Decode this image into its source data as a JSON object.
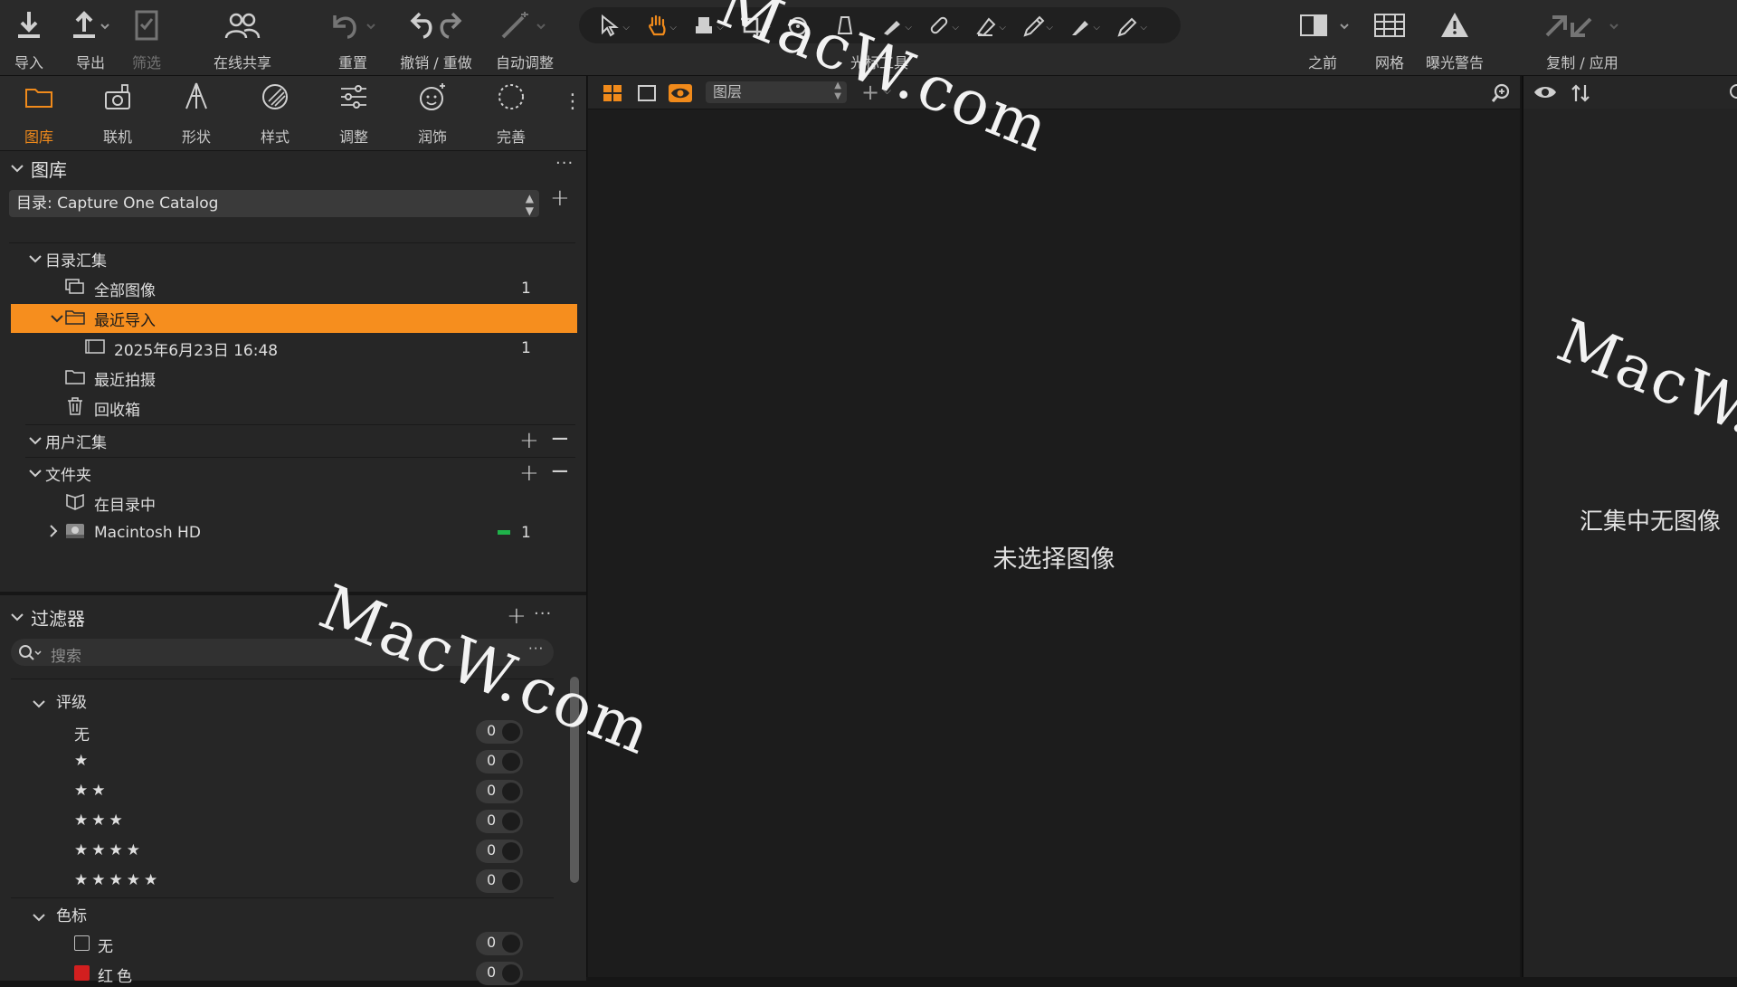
{
  "toolbar": {
    "import": "导入",
    "export": "导出",
    "filter": "筛选",
    "share": "在线共享",
    "reset": "重置",
    "undo_redo": "撤销 / 重做",
    "auto_adjust": "自动调整",
    "cursor_tools": "光标工具",
    "before": "之前",
    "grid": "网格",
    "exposure_warning": "曝光警告",
    "copy_apply": "复制 / 应用"
  },
  "tabs": [
    "图库",
    "联机",
    "形状",
    "样式",
    "调整",
    "润饰",
    "完善"
  ],
  "library": {
    "title": "图库",
    "catalog": "目录: Capture One Catalog",
    "catalog_collections": "目录汇集",
    "all_images": "全部图像",
    "all_images_count": "1",
    "recent_imports": "最近导入",
    "import_date": "2025年6月23日 16:48",
    "import_date_count": "1",
    "recent_captures": "最近拍摄",
    "trash": "回收箱",
    "user_collections": "用户汇集",
    "folders": "文件夹",
    "in_catalog": "在目录中",
    "macintosh_hd": "Macintosh HD",
    "macintosh_hd_count": "1"
  },
  "filters": {
    "title": "过滤器",
    "search_placeholder": "搜索",
    "rating_title": "评级",
    "ratings": [
      {
        "label": "无",
        "count": "0"
      },
      {
        "label": "★",
        "count": "0"
      },
      {
        "label": "★★",
        "count": "0"
      },
      {
        "label": "★★★",
        "count": "0"
      },
      {
        "label": "★★★★",
        "count": "0"
      },
      {
        "label": "★★★★★",
        "count": "0"
      }
    ],
    "color_tag_title": "色标",
    "color_tags": [
      {
        "label": "无",
        "count": "0"
      },
      {
        "label": "红色",
        "count": "0"
      }
    ]
  },
  "viewer": {
    "layer_placeholder": "图层",
    "no_image_selected": "未选择图像"
  },
  "browser": {
    "no_images_in_collection": "汇集中无图像"
  },
  "watermark": "MacW.com",
  "colors": {
    "accent": "#f08a1b",
    "selection": "#f68e1e",
    "drive_indicator": "#1fb24a",
    "red_tag": "#d21f1f"
  }
}
